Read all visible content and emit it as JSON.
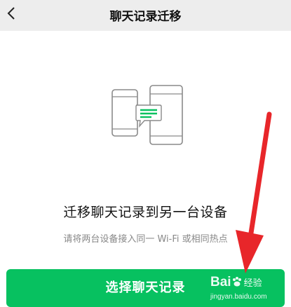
{
  "header": {
    "title": "聊天记录迁移",
    "back_icon": "chevron-left-icon"
  },
  "illustration": {
    "icon": "two-phones-transfer-icon",
    "accent_color": "#07c160"
  },
  "main": {
    "heading": "迁移聊天记录到另一台设备",
    "subtext": "请将两台设备接入同一 Wi-Fi 或相同热点"
  },
  "actions": {
    "select_button_label": "选择聊天记录",
    "button_color": "#07c160"
  },
  "overlay": {
    "arrow_color": "#e8262a",
    "watermark_logo": "Bai",
    "watermark_logo_suffix": "经验",
    "watermark_url": "jingyan.baidu.com"
  }
}
